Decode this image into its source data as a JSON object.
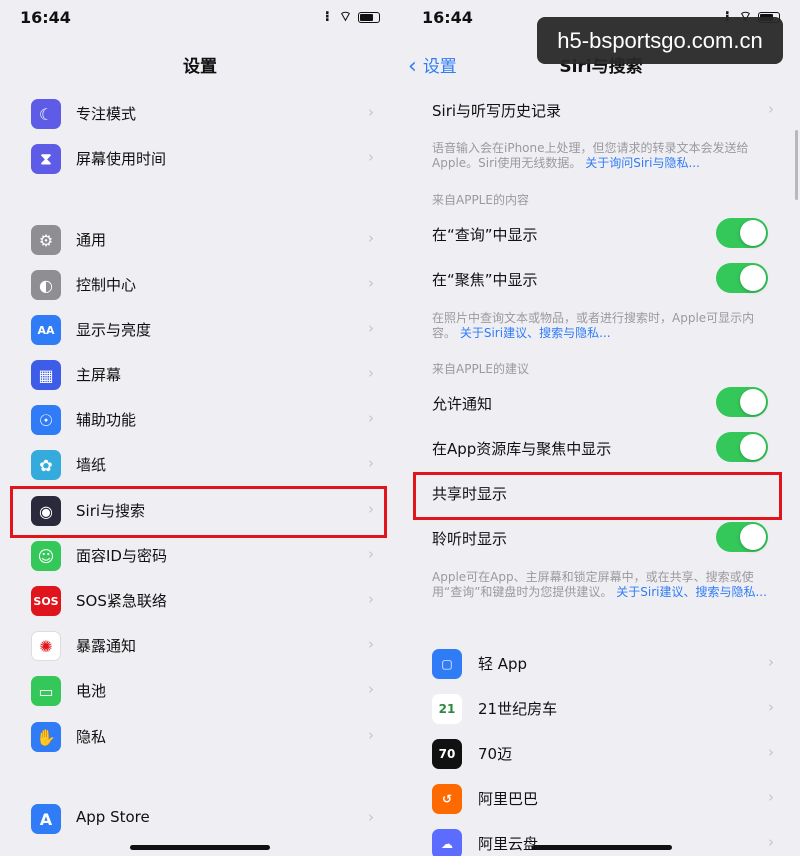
{
  "status": {
    "time": "16:44"
  },
  "watermark": "h5-bsportsgo.com.cn",
  "left": {
    "title": "设置",
    "rows": [
      {
        "label": "专注模式",
        "icon": "moon-icon",
        "color": "#5e5ce6",
        "glyph": "☾"
      },
      {
        "label": "屏幕使用时间",
        "icon": "hourglass-icon",
        "color": "#5e5ce6",
        "glyph": "⧗"
      },
      {
        "label": "通用",
        "icon": "gear-icon",
        "color": "#8e8e93",
        "glyph": "⚙"
      },
      {
        "label": "控制中心",
        "icon": "toggles-icon",
        "color": "#8e8e93",
        "glyph": "◐"
      },
      {
        "label": "显示与亮度",
        "icon": "text-size-icon",
        "color": "#2f7cf6",
        "glyph": "AA"
      },
      {
        "label": "主屏幕",
        "icon": "home-grid-icon",
        "color": "#3d5de8",
        "glyph": "▦"
      },
      {
        "label": "辅助功能",
        "icon": "accessibility-icon",
        "color": "#2f7cf6",
        "glyph": "☉"
      },
      {
        "label": "墙纸",
        "icon": "flower-icon",
        "color": "#35aadc",
        "glyph": "✿"
      },
      {
        "label": "Siri与搜索",
        "icon": "siri-icon",
        "color": "#2a2a3c",
        "glyph": "◉"
      },
      {
        "label": "面容ID与密码",
        "icon": "faceid-icon",
        "color": "#34c759",
        "glyph": "☺"
      },
      {
        "label": "SOS紧急联络",
        "icon": "sos-icon",
        "color": "#e0141c",
        "glyph": "SOS"
      },
      {
        "label": "暴露通知",
        "icon": "exposure-icon",
        "color": "#ffffff",
        "glyph": "✺"
      },
      {
        "label": "电池",
        "icon": "battery-icon",
        "color": "#34c759",
        "glyph": "▭"
      },
      {
        "label": "隐私",
        "icon": "hand-icon",
        "color": "#2f7cf6",
        "glyph": "✋"
      },
      {
        "label": "App Store",
        "icon": "app-store-icon",
        "color": "#2f7cf6",
        "glyph": "A"
      }
    ]
  },
  "right": {
    "back_label": "设置",
    "title": "Siri与搜索",
    "history_row": "Siri与听写历史记录",
    "footnote1": "语音输入会在iPhone上处理，但您请求的转录文本会发送给Apple。Siri使用无线数据。",
    "footnote1_link": "关于询问Siri与隐私...",
    "section1": "来自APPLE的内容",
    "toggle_query": "在“查询”中显示",
    "toggle_spotlight": "在“聚焦”中显示",
    "footnote2": "在照片中查询文本或物品，或者进行搜索时，Apple可显示内容。",
    "footnote2_link": "关于Siri建议、搜索与隐私...",
    "section2": "来自APPLE的建议",
    "toggle_notify": "允许通知",
    "toggle_library": "在App资源库与聚焦中显示",
    "share_row": "共享时显示",
    "toggle_listen": "聆听时显示",
    "footnote3": "Apple可在App、主屏幕和锁定屏幕中，或在共享、搜索或使用“查询”和键盘时为您提供建议。",
    "footnote3_link": "关于Siri建议、搜索与隐私...",
    "apps": [
      {
        "label": "轻 App",
        "icon": "qing-app-icon",
        "color": "#2f7cf6"
      },
      {
        "label": "21世纪房车",
        "icon": "rv21-app-icon",
        "color": "#ffffff"
      },
      {
        "label": "70迈",
        "icon": "70mai-app-icon",
        "color": "#111111"
      },
      {
        "label": "阿里巴巴",
        "icon": "alibaba-app-icon",
        "color": "#ff6a00"
      },
      {
        "label": "阿里云盘",
        "icon": "aliyun-drive-app-icon",
        "color": "#5b6cff"
      }
    ]
  }
}
